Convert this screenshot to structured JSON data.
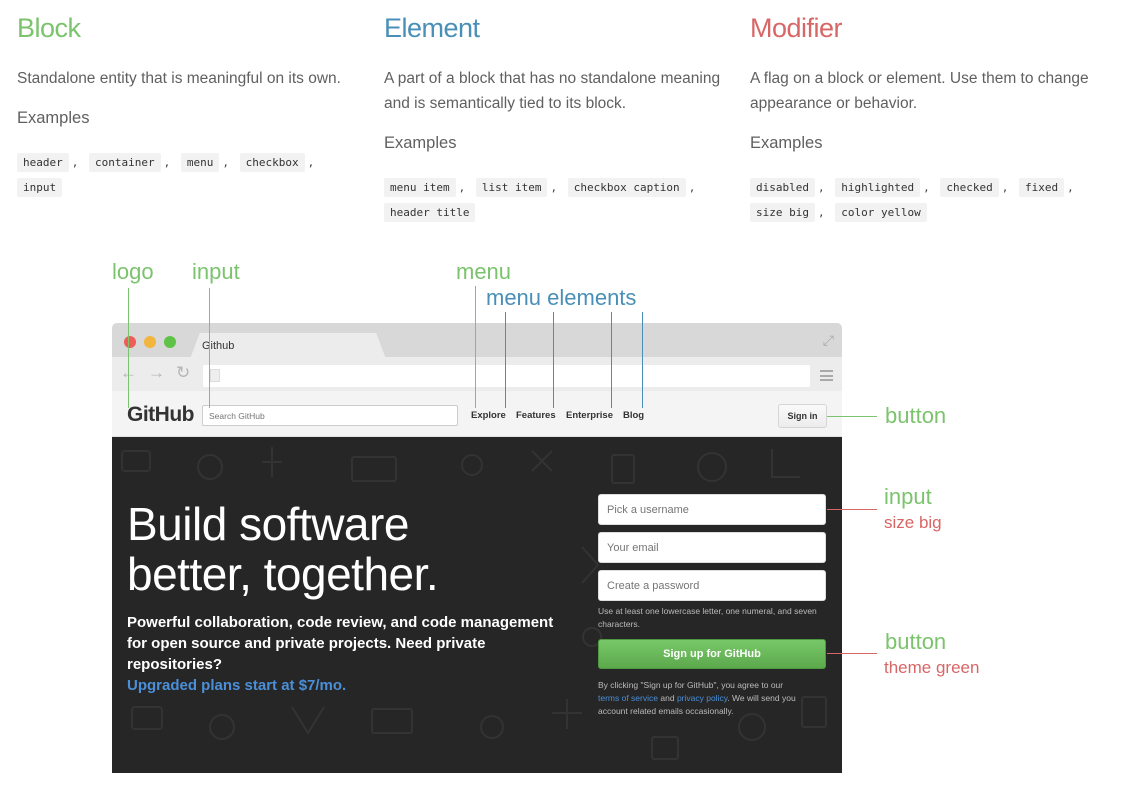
{
  "columns": {
    "block": {
      "title": "Block",
      "description": "Standalone entity that is meaningful on its own.",
      "examples_label": "Examples",
      "examples": [
        "header",
        "container",
        "menu",
        "checkbox",
        "input"
      ]
    },
    "element": {
      "title": "Element",
      "description": "A part of a block that has no standalone meaning and is semantically tied to its block.",
      "examples_label": "Examples",
      "examples": [
        "menu item",
        "list item",
        "checkbox caption",
        "header title"
      ]
    },
    "modifier": {
      "title": "Modifier",
      "description": "A flag on a block or element. Use them to change appearance or behavior.",
      "examples_label": "Examples",
      "examples": [
        "disabled",
        "highlighted",
        "checked",
        "fixed",
        "size big",
        "color yellow"
      ]
    }
  },
  "annotations": {
    "logo": "logo",
    "input": "input",
    "menu": "menu",
    "menu_elements": "menu elements",
    "button": "button",
    "hero_input": "input",
    "hero_input_mod": "size big",
    "hero_button": "button",
    "hero_button_mod": "theme green"
  },
  "browser": {
    "tab_title": "Github"
  },
  "github": {
    "logo": "GitHub",
    "search_placeholder": "Search GitHub",
    "nav": [
      "Explore",
      "Features",
      "Enterprise",
      "Blog"
    ],
    "sign_in": "Sign in",
    "headline_line1": "Build software",
    "headline_line2": "better, together.",
    "lead": "Powerful collaboration, code review, and code management for open source and private projects. Need private repositories?",
    "lead_link": "Upgraded plans start at $7/mo.",
    "username_placeholder": "Pick a username",
    "email_placeholder": "Your email",
    "password_placeholder": "Create a password",
    "password_hint": "Use at least one lowercase letter, one numeral, and seven characters.",
    "signup_button": "Sign up for GitHub",
    "legal_pre": "By clicking \"Sign up for GitHub\", you agree to our",
    "legal_terms": "terms of service",
    "legal_and": "and",
    "legal_privacy": "privacy policy",
    "legal_post": ". We will send you account related emails occasionally."
  },
  "colors": {
    "block": "#7bc36c",
    "element": "#4a8fb8",
    "modifier": "#d96666",
    "hero_bg": "#262626",
    "signup_green": "#6dba5e",
    "link_blue": "#4a8fd8"
  }
}
